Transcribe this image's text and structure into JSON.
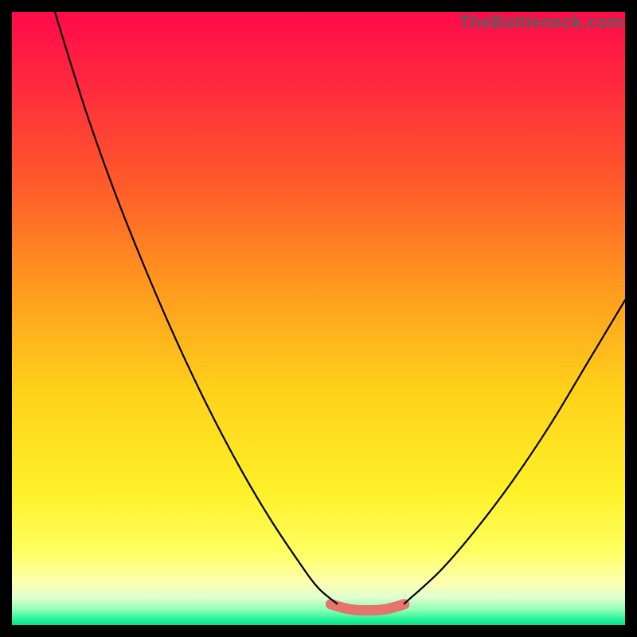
{
  "watermark": {
    "text": "TheBottleneck.com"
  },
  "chart_data": {
    "type": "line",
    "title": "",
    "xlabel": "",
    "ylabel": "",
    "xlim": [
      0,
      100
    ],
    "ylim": [
      0,
      100
    ],
    "grid": false,
    "legend": false,
    "series": [
      {
        "name": "left-curve-black",
        "x": [
          7,
          12,
          17,
          22,
          27,
          32,
          37,
          42,
          47,
          50,
          53
        ],
        "values": [
          100,
          84,
          70,
          57.5,
          46,
          35.5,
          26,
          17.5,
          10,
          6,
          3.5
        ]
      },
      {
        "name": "right-curve-black",
        "x": [
          64,
          70,
          76,
          82,
          88,
          94,
          100
        ],
        "values": [
          3.5,
          9,
          16,
          24,
          33,
          43,
          53
        ]
      },
      {
        "name": "flat-bottom-salmon",
        "x": [
          52,
          55,
          58,
          61,
          64
        ],
        "values": [
          3.4,
          2.6,
          2.4,
          2.6,
          3.4
        ]
      }
    ],
    "background_gradient": {
      "stops": [
        {
          "offset": 0.0,
          "color": "#ff0a4a"
        },
        {
          "offset": 0.12,
          "color": "#ff2a3e"
        },
        {
          "offset": 0.28,
          "color": "#ff5a2a"
        },
        {
          "offset": 0.45,
          "color": "#ff9a1e"
        },
        {
          "offset": 0.62,
          "color": "#ffd21a"
        },
        {
          "offset": 0.78,
          "color": "#fff028"
        },
        {
          "offset": 0.88,
          "color": "#feff60"
        },
        {
          "offset": 0.93,
          "color": "#fdffb0"
        },
        {
          "offset": 0.955,
          "color": "#e0ffcf"
        },
        {
          "offset": 0.975,
          "color": "#90ffb5"
        },
        {
          "offset": 0.99,
          "color": "#28f59a"
        },
        {
          "offset": 1.0,
          "color": "#06e28a"
        }
      ]
    },
    "colors": {
      "curve_black": "#000000",
      "flat_salmon": "#e4746c"
    }
  }
}
